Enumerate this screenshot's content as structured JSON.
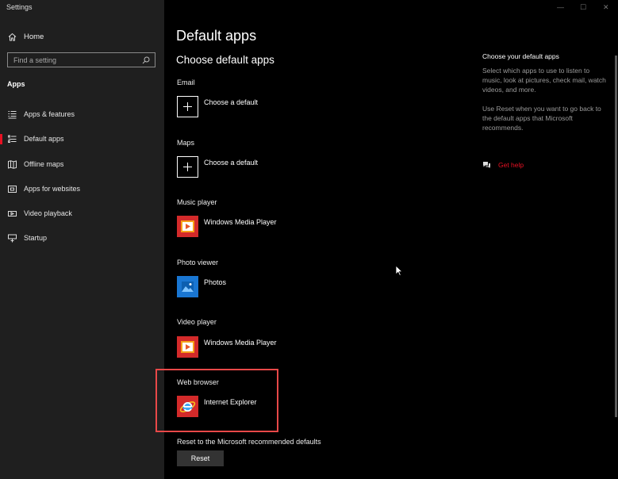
{
  "window": {
    "title": "Settings",
    "caption": {
      "minimize": "—",
      "maximize": "☐",
      "close": "✕"
    }
  },
  "sidebar": {
    "home": "Home",
    "search_placeholder": "Find a setting",
    "section": "Apps",
    "items": [
      {
        "label": "Apps & features",
        "icon": "apps-features-icon"
      },
      {
        "label": "Default apps",
        "icon": "default-apps-icon",
        "active": true
      },
      {
        "label": "Offline maps",
        "icon": "offline-maps-icon"
      },
      {
        "label": "Apps for websites",
        "icon": "apps-for-websites-icon"
      },
      {
        "label": "Video playback",
        "icon": "video-playback-icon"
      },
      {
        "label": "Startup",
        "icon": "startup-icon"
      }
    ]
  },
  "main": {
    "title": "Default apps",
    "subtitle": "Choose default apps",
    "categories": [
      {
        "label": "Email",
        "app": "Choose a default",
        "icon": "plus-icon"
      },
      {
        "label": "Maps",
        "app": "Choose a default",
        "icon": "plus-icon"
      },
      {
        "label": "Music player",
        "app": "Windows Media Player",
        "icon": "windows-media-player-icon"
      },
      {
        "label": "Photo viewer",
        "app": "Photos",
        "icon": "photos-icon"
      },
      {
        "label": "Video player",
        "app": "Windows Media Player",
        "icon": "windows-media-player-icon"
      },
      {
        "label": "Web browser",
        "app": "Internet Explorer",
        "icon": "internet-explorer-icon"
      }
    ],
    "reset_label": "Reset to the Microsoft recommended defaults",
    "reset_button": "Reset"
  },
  "right_panel": {
    "title": "Choose your default apps",
    "text1": "Select which apps to use to listen to music, look at pictures, check mail, watch videos, and more.",
    "text2": "Use Reset when you want to go back to the default apps that Microsoft recommends.",
    "help": "Get help"
  },
  "colors": {
    "accent": "#e81123",
    "highlight": "#e84848",
    "sidebar": "#1f1f1f",
    "background": "#000000"
  }
}
